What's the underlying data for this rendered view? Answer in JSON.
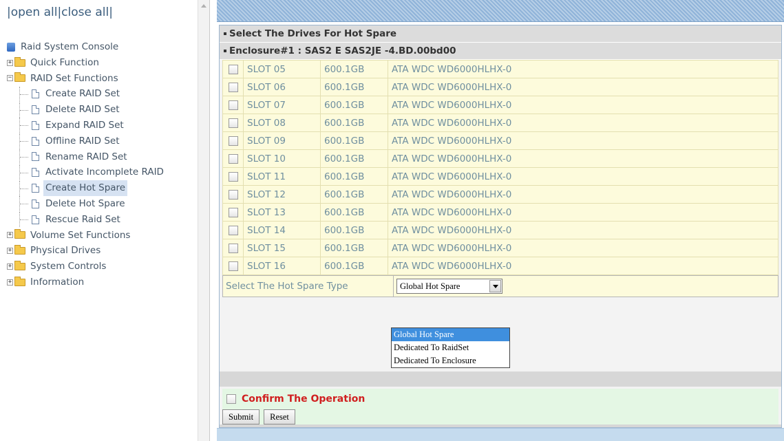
{
  "tree": {
    "open_all": "open all",
    "close_all": "close all",
    "root": "Raid System Console",
    "items": [
      {
        "label": "Quick Function",
        "kind": "folder",
        "expander": "+"
      },
      {
        "label": "RAID Set Functions",
        "kind": "folder",
        "expander": "−"
      },
      {
        "label": "Create RAID Set",
        "kind": "doc"
      },
      {
        "label": "Delete RAID Set",
        "kind": "doc"
      },
      {
        "label": "Expand RAID Set",
        "kind": "doc"
      },
      {
        "label": "Offline RAID Set",
        "kind": "doc"
      },
      {
        "label": "Rename RAID Set",
        "kind": "doc"
      },
      {
        "label": "Activate Incomplete RAID",
        "kind": "doc"
      },
      {
        "label": "Create Hot Spare",
        "kind": "doc",
        "selected": true
      },
      {
        "label": "Delete Hot Spare",
        "kind": "doc"
      },
      {
        "label": "Rescue Raid Set",
        "kind": "doc"
      },
      {
        "label": "Volume Set Functions",
        "kind": "folder",
        "expander": "+"
      },
      {
        "label": "Physical Drives",
        "kind": "folder",
        "expander": "+"
      },
      {
        "label": "System Controls",
        "kind": "folder",
        "expander": "+"
      },
      {
        "label": "Information",
        "kind": "folder",
        "expander": "+"
      }
    ]
  },
  "main": {
    "section_title": "Select The Drives For Hot Spare",
    "enclosure_title": "Enclosure#1 : SAS2 E SAS2JE -4.BD.00bd00",
    "drives": [
      {
        "slot": "SLOT 05",
        "size": "600.1GB",
        "model": "ATA WDC WD6000HLHX-0"
      },
      {
        "slot": "SLOT 06",
        "size": "600.1GB",
        "model": "ATA WDC WD6000HLHX-0"
      },
      {
        "slot": "SLOT 07",
        "size": "600.1GB",
        "model": "ATA WDC WD6000HLHX-0"
      },
      {
        "slot": "SLOT 08",
        "size": "600.1GB",
        "model": "ATA WDC WD6000HLHX-0"
      },
      {
        "slot": "SLOT 09",
        "size": "600.1GB",
        "model": "ATA WDC WD6000HLHX-0"
      },
      {
        "slot": "SLOT 10",
        "size": "600.1GB",
        "model": "ATA WDC WD6000HLHX-0"
      },
      {
        "slot": "SLOT 11",
        "size": "600.1GB",
        "model": "ATA WDC WD6000HLHX-0"
      },
      {
        "slot": "SLOT 12",
        "size": "600.1GB",
        "model": "ATA WDC WD6000HLHX-0"
      },
      {
        "slot": "SLOT 13",
        "size": "600.1GB",
        "model": "ATA WDC WD6000HLHX-0"
      },
      {
        "slot": "SLOT 14",
        "size": "600.1GB",
        "model": "ATA WDC WD6000HLHX-0"
      },
      {
        "slot": "SLOT 15",
        "size": "600.1GB",
        "model": "ATA WDC WD6000HLHX-0"
      },
      {
        "slot": "SLOT 16",
        "size": "600.1GB",
        "model": "ATA WDC WD6000HLHX-0"
      }
    ],
    "hot_spare_type_label": "Select The Hot Spare Type",
    "hot_spare_type_selected": "Global Hot Spare",
    "hot_spare_type_options": [
      "Global Hot Spare",
      "Dedicated To RaidSet",
      "Dedicated To Enclosure"
    ],
    "confirm_label": "Confirm The Operation",
    "submit_label": "Submit",
    "reset_label": "Reset"
  },
  "colors": {
    "accent_confirm": "#d02020",
    "dropdown_highlight": "#3f8fde",
    "row_background": "#fdfbdc",
    "selected_tree_item": "#d6e2f2"
  }
}
